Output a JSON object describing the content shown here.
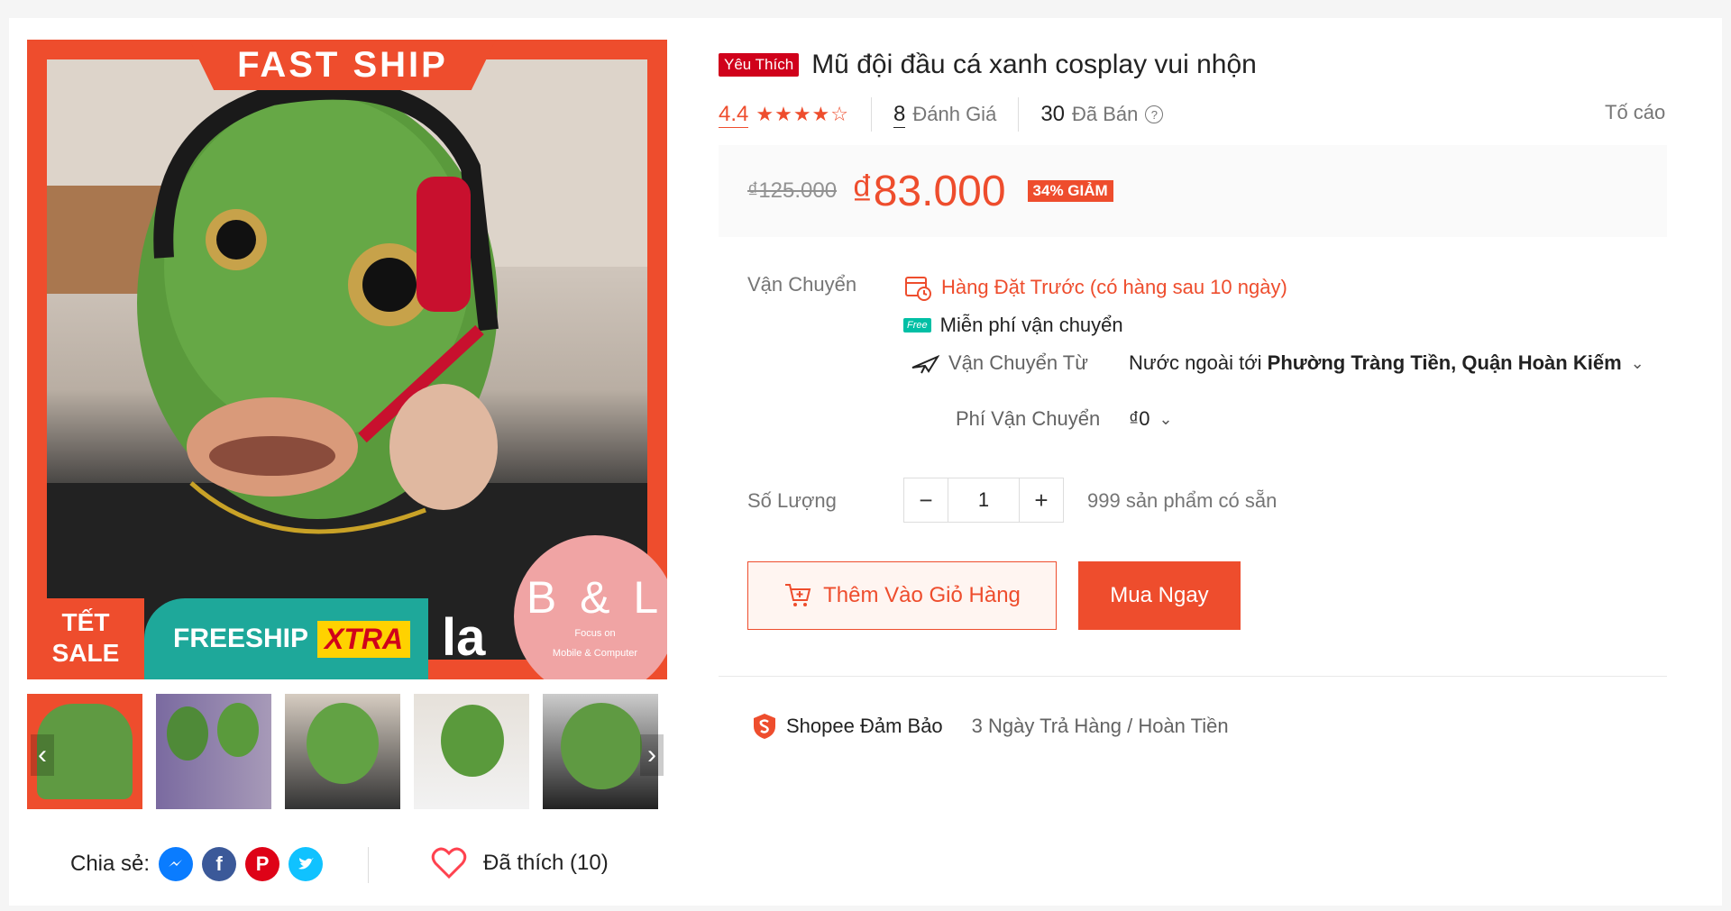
{
  "gallery": {
    "fast_ship": "FAST SHIP",
    "tet_line1": "TẾT",
    "tet_line2": "SALE",
    "freeship": "FREESHIP",
    "xtra": "XTRA",
    "brand_overlay": "la",
    "brand_name": "B & L",
    "brand_tag1": "Focus on",
    "brand_tag2": "Mobile & Computer",
    "thumb_count": 5,
    "active_thumb": 1,
    "arrow_left": "‹",
    "arrow_right": "›"
  },
  "share": {
    "label": "Chia sẻ:",
    "networks": [
      "messenger-icon",
      "facebook-icon",
      "pinterest-icon",
      "twitter-icon"
    ],
    "liked_label": "Đã thích (10)"
  },
  "product": {
    "badge": "Yêu Thích",
    "title": "Mũ đội đầu cá xanh cosplay vui nhộn",
    "rating": "4.4",
    "rating_value": 4.4,
    "reviews_count": "8",
    "reviews_label": "Đánh Giá",
    "sold_count": "30",
    "sold_label": "Đã Bán",
    "report": "Tố cáo"
  },
  "price": {
    "old": "₫125.000",
    "current": "₫83.000",
    "discount": "34% GIẢM"
  },
  "shipping": {
    "label": "Vận Chuyển",
    "preorder": "Hàng Đặt Trước (có hàng sau 10 ngày)",
    "free_tag": "Free",
    "free_text": "Miễn phí vận chuyển",
    "from_label": "Vận Chuyển Từ",
    "from_value_prefix": "Nước ngoài tới",
    "from_value_dest": "Phường Tràng Tiền, Quận Hoàn Kiếm",
    "fee_label": "Phí Vận Chuyển",
    "fee_value": "₫0"
  },
  "quantity": {
    "label": "Số Lượng",
    "value": "1",
    "minus": "−",
    "plus": "+",
    "stock": "999 sản phẩm có sẵn"
  },
  "actions": {
    "add_to_cart": "Thêm Vào Giỏ Hàng",
    "buy_now": "Mua Ngay"
  },
  "guarantee": {
    "title": "Shopee Đảm Bảo",
    "text": "3 Ngày Trả Hàng / Hoàn Tiền"
  },
  "colors": {
    "accent": "#ee4d2d",
    "free_green": "#00bfa5"
  }
}
